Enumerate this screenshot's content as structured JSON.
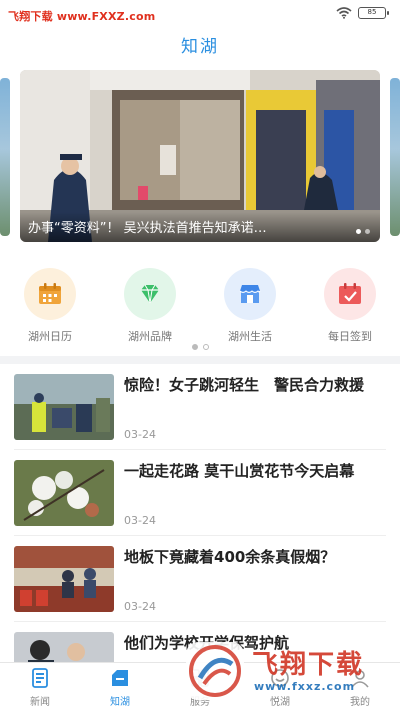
{
  "watermark": {
    "site": "飞翔下载 www.FXXZ.com",
    "logo_text": "飞翔下载",
    "logo_url": "www.fxxz.com"
  },
  "status": {
    "battery": "85"
  },
  "app": {
    "title": "知湖"
  },
  "banner": {
    "caption": "办事“零资料”！ 吴兴执法首推告知承诺…",
    "slides": 2,
    "active_slide": 1
  },
  "quick_links": [
    {
      "label": "湖州日历",
      "icon": "calendar-icon",
      "bg": "#fdf0dc",
      "color": "#f0a43a"
    },
    {
      "label": "湖州品牌",
      "icon": "diamond-icon",
      "bg": "#e2f6e9",
      "color": "#3cbf6a"
    },
    {
      "label": "湖州生活",
      "icon": "store-icon",
      "bg": "#e4eefc",
      "color": "#3e86e8"
    },
    {
      "label": "每日签到",
      "icon": "checkin-calendar-icon",
      "bg": "#fde6e6",
      "color": "#ec5a5a"
    }
  ],
  "news": [
    {
      "title": "惊险！女子跳河轻生　警民合力救援",
      "date": "03-24"
    },
    {
      "title": "一起走花路 莫干山赏花节今天启幕",
      "date": "03-24"
    },
    {
      "title": "地板下竟藏着400余条真假烟？",
      "date": "03-24"
    },
    {
      "title": "他们为学校开学保驾护航",
      "date": ""
    }
  ],
  "tabs": [
    {
      "label": "新闻",
      "icon": "news-icon",
      "active": false
    },
    {
      "label": "知湖",
      "icon": "zhihu-home-icon",
      "active": true
    },
    {
      "label": "服务",
      "icon": "service-icon",
      "active": false
    },
    {
      "label": "悦湖",
      "icon": "yuehu-icon",
      "active": false
    },
    {
      "label": "我的",
      "icon": "profile-icon",
      "active": false
    }
  ],
  "colors": {
    "accent": "#2b8fe0",
    "watermark_red": "#e0301e"
  }
}
